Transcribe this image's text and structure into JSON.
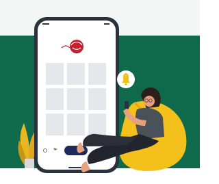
{
  "illustration": {
    "subject": "woman-on-beanbag-with-phone-notification",
    "colors": {
      "background_top": "#f4f6f5",
      "background_green": "#0f6a4b",
      "phone_frame": "#2c3140",
      "phone_screen": "#ffffff",
      "grid_tile": "#e6e7ea",
      "accent_red": "#c4202f",
      "button_navy": "#1f2a5a",
      "beanbag_yellow": "#f4c01c",
      "bell_yellow": "#f4c01c",
      "pants_dark": "#22252d",
      "shirt_gray": "#4b5158",
      "skin": "#e8a17f",
      "hair": "#2d1e1c",
      "plant_yellow": "#e6b623"
    }
  },
  "phone": {
    "logo_caption": "",
    "button_label": "",
    "grid_rows": 4,
    "grid_cols": 3
  }
}
